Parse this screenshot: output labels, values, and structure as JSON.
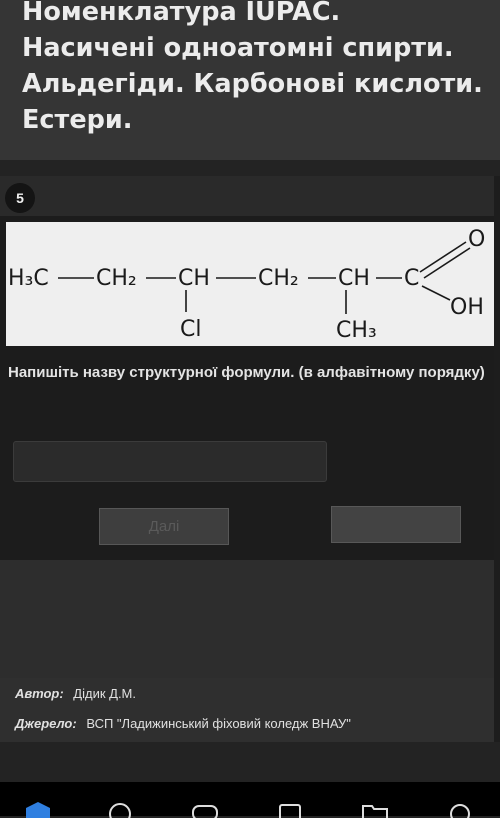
{
  "header": {
    "title_lines": [
      "Номенклатура IUPAC.",
      "Насичені одноатомні спирти.",
      "Альдегіди. Карбонові кислоти.",
      "Естери."
    ]
  },
  "question": {
    "number": "5",
    "prompt": "Напишіть назву структурної формули. (в алфавітному порядку)",
    "answer_value": "",
    "formula": {
      "main_chain": [
        "H₃C",
        "CH₂",
        "CH",
        "CH₂",
        "CH",
        "C"
      ],
      "substituent_cl": "Cl",
      "substituent_ch3": "CH₃",
      "carbonyl_o": "O",
      "hydroxyl": "OH"
    }
  },
  "buttons": {
    "next_label": "Далі",
    "right_label": ""
  },
  "meta": {
    "author_key": "Автор:",
    "author_value": "Дідик Д.М.",
    "source_key": "Джерело:",
    "source_value": "ВСП \"Ладижинський фіховий коледж ВНАУ\""
  },
  "colors": {
    "background": "#232323",
    "header_bg": "#353535",
    "card_bg": "#1c1c1c",
    "nav_accent": "#2f7fe0"
  },
  "nav_icons": [
    "home-icon",
    "compass-icon",
    "gamepad-icon",
    "tasks-icon",
    "folder-icon",
    "profile-icon"
  ]
}
